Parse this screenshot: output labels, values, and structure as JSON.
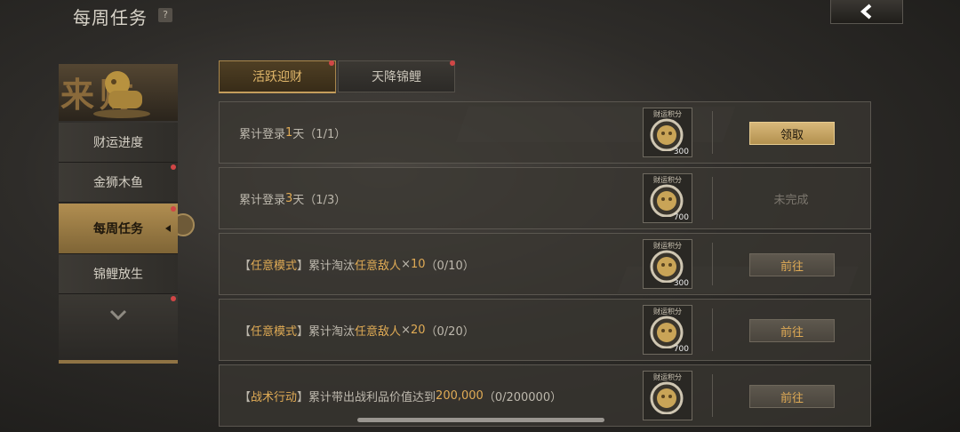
{
  "header": {
    "title": "每周任务",
    "help": "?"
  },
  "sidebar": {
    "banner_text": "来财",
    "items": [
      {
        "label": "财运进度"
      },
      {
        "label": "金狮木鱼"
      },
      {
        "label": "每周任务"
      },
      {
        "label": "锦鲤放生"
      }
    ]
  },
  "tabs": [
    {
      "label": "活跃迎财"
    },
    {
      "label": "天降锦鲤"
    }
  ],
  "reward_label": "财运积分",
  "tasks": [
    {
      "desc": [
        {
          "t": "累计登录"
        },
        {
          "t": "1",
          "hl": true
        },
        {
          "t": "天（1/1）"
        }
      ],
      "amount": "300",
      "action": "领取"
    },
    {
      "desc": [
        {
          "t": "累计登录"
        },
        {
          "t": "3",
          "hl": true
        },
        {
          "t": "天（1/3）"
        }
      ],
      "amount": "700",
      "action": "未完成"
    },
    {
      "desc": [
        {
          "t": "【"
        },
        {
          "t": "任意模式",
          "hl": true
        },
        {
          "t": "】累计淘汰"
        },
        {
          "t": "任意敌人",
          "hl": true
        },
        {
          "t": "×"
        },
        {
          "t": "10",
          "hl": true
        },
        {
          "t": "（0/10）"
        }
      ],
      "amount": "300",
      "action": "前往"
    },
    {
      "desc": [
        {
          "t": "【"
        },
        {
          "t": "任意模式",
          "hl": true
        },
        {
          "t": "】累计淘汰"
        },
        {
          "t": "任意敌人",
          "hl": true
        },
        {
          "t": "×"
        },
        {
          "t": "20",
          "hl": true
        },
        {
          "t": "（0/20）"
        }
      ],
      "amount": "700",
      "action": "前往"
    },
    {
      "desc": [
        {
          "t": "【"
        },
        {
          "t": "战术行动",
          "hl": true
        },
        {
          "t": "】累计带出战利品价值达到"
        },
        {
          "t": "200,000",
          "hl": true
        },
        {
          "t": "（0/200000）"
        }
      ],
      "amount": "",
      "action": "前往"
    }
  ],
  "colors": {
    "accent": "#e0ab55",
    "claim_bg": "#d8b87a",
    "red_dot": "#d14646"
  },
  "icons": {
    "back": "chevron-left-icon",
    "more": "chevron-down-icon",
    "reward": "coin-lion-icon"
  }
}
